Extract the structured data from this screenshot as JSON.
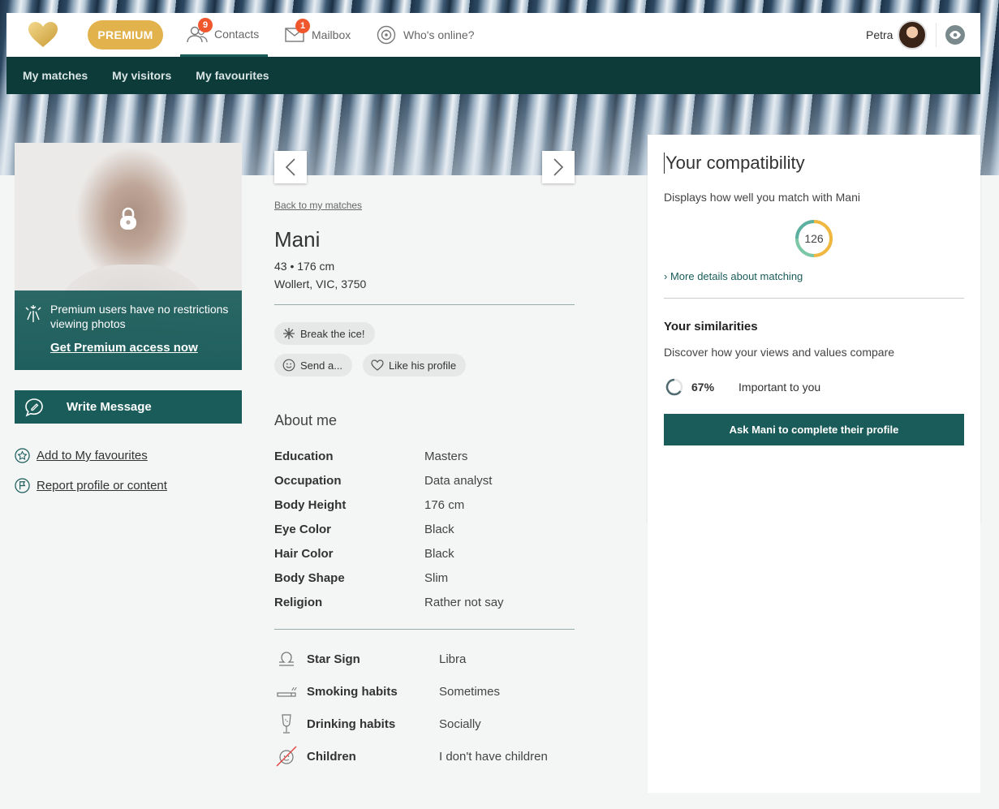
{
  "header": {
    "premium_label": "PREMIUM",
    "nav": [
      {
        "label": "Contacts",
        "badge": "9"
      },
      {
        "label": "Mailbox",
        "badge": "1"
      },
      {
        "label": "Who's online?"
      }
    ],
    "user_name": "Petra"
  },
  "subnav": [
    "My matches",
    "My visitors",
    "My favourites"
  ],
  "sidebar": {
    "promo_text": "Premium users have no restrictions viewing photos",
    "promo_link": "Get Premium access now",
    "write_message": "Write Message",
    "add_favourite": "Add to My favourites",
    "report": "Report profile or content"
  },
  "profile": {
    "back_link": "Back to my matches",
    "name": "Mani",
    "age_height": "43 • 176 cm",
    "location": "Wollert, VIC, 3750",
    "actions": {
      "break_ice": "Break the ice!",
      "send": "Send a...",
      "like": "Like his profile"
    },
    "about_title": "About me",
    "details": [
      {
        "k": "Education",
        "v": "Masters"
      },
      {
        "k": "Occupation",
        "v": "Data analyst"
      },
      {
        "k": "Body Height",
        "v": "176 cm"
      },
      {
        "k": "Eye Color",
        "v": "Black"
      },
      {
        "k": "Hair Color",
        "v": "Black"
      },
      {
        "k": "Body Shape",
        "v": "Slim"
      },
      {
        "k": "Religion",
        "v": "Rather not say"
      }
    ],
    "lifestyle": [
      {
        "k": "Star Sign",
        "v": "Libra",
        "icon": "libra-icon"
      },
      {
        "k": "Smoking habits",
        "v": "Sometimes",
        "icon": "cigarette-icon"
      },
      {
        "k": "Drinking habits",
        "v": "Socially",
        "icon": "glass-icon"
      },
      {
        "k": "Children",
        "v": "I don't have children",
        "icon": "no-children-icon"
      }
    ]
  },
  "compatibility": {
    "title": "Your compatibility",
    "subtitle": "Displays how well you match with Mani",
    "score": "126",
    "more_link": "More details about matching",
    "similarities_title": "Your similarities",
    "similarities_sub": "Discover how your views and values compare",
    "percent": "67%",
    "percent_label": "Important to you",
    "ask_button": "Ask Mani to complete their profile"
  },
  "colors": {
    "teal": "#1a5c5a",
    "dark_teal": "#0d3b3a",
    "gold": "#e2b24c",
    "badge": "#f0572c"
  }
}
